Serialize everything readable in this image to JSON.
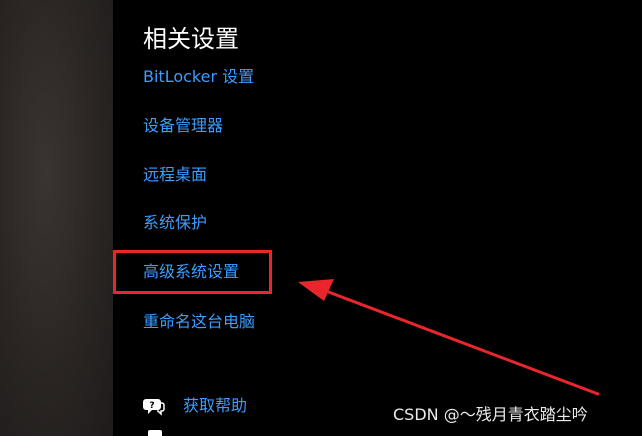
{
  "related_settings": {
    "title": "相关设置",
    "links": [
      "BitLocker 设置",
      "设备管理器",
      "远程桌面",
      "系统保护",
      "高级系统设置",
      "重命名这台电脑"
    ]
  },
  "help": {
    "label": "获取帮助",
    "icon": "help-chat-icon"
  },
  "annotation": {
    "highlight_color": "#e8262b"
  },
  "watermark": "CSDN @～残月青衣踏尘吟",
  "colors": {
    "link": "#3c9cff",
    "background": "#000000",
    "heading": "#ffffff"
  }
}
